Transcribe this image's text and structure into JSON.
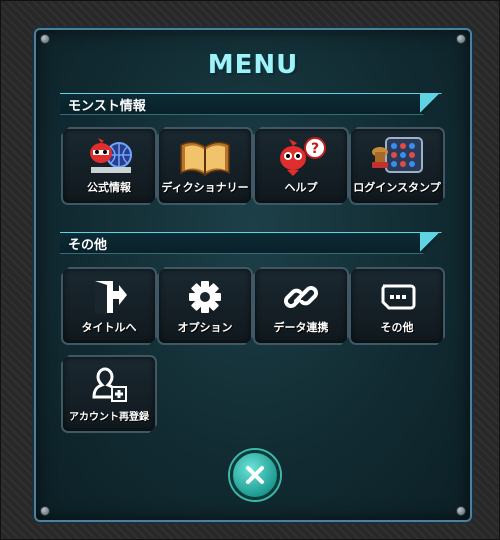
{
  "menu": {
    "title": "MENU"
  },
  "sections": {
    "monst_info": {
      "label": "モンスト情報",
      "items": [
        {
          "label": "公式情報",
          "icon": "official-info-icon"
        },
        {
          "label": "ディクショナリー",
          "icon": "dictionary-book-icon"
        },
        {
          "label": "ヘルプ",
          "icon": "help-icon"
        },
        {
          "label": "ログインスタンプ",
          "icon": "login-stamp-icon"
        }
      ]
    },
    "other": {
      "label": "その他",
      "items": [
        {
          "label": "タイトルへ",
          "icon": "exit-door-icon"
        },
        {
          "label": "オプション",
          "icon": "gear-icon"
        },
        {
          "label": "データ連携",
          "icon": "link-icon"
        },
        {
          "label": "その他",
          "icon": "more-dots-icon"
        },
        {
          "label": "アカウント再登録",
          "icon": "account-add-icon"
        }
      ]
    }
  },
  "close": {
    "icon": "close-icon"
  },
  "colors": {
    "title": "#9ff3f8",
    "accent": "#5fd3e2",
    "close_button": "#1f9c92"
  }
}
